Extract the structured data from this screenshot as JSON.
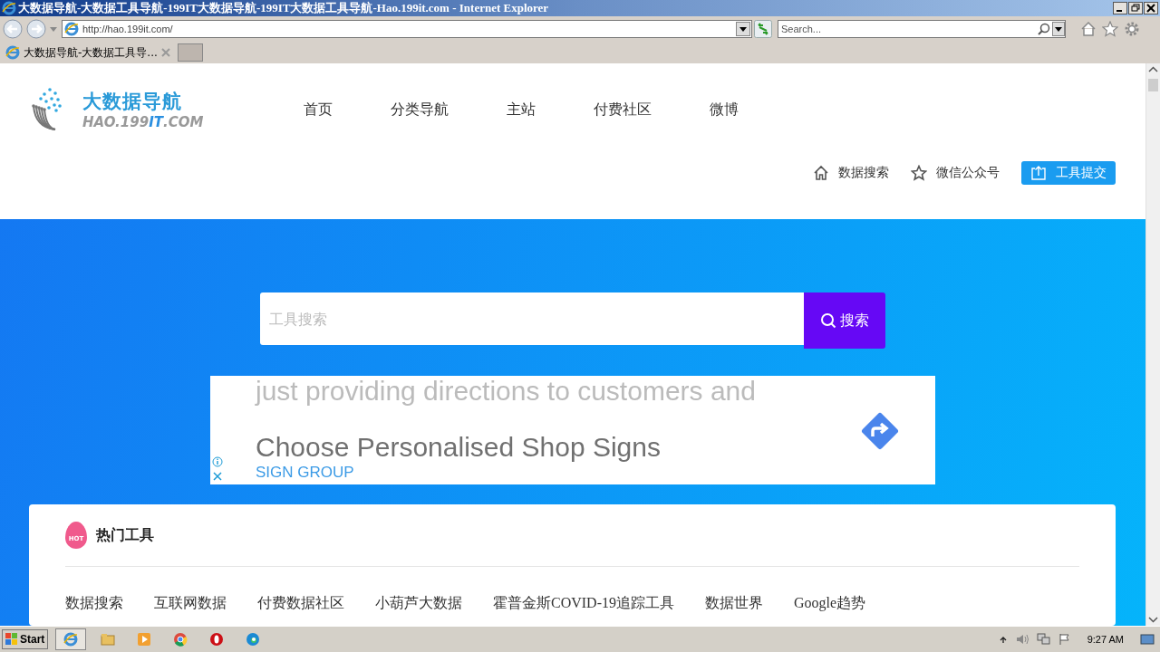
{
  "window": {
    "title": "大数据导航-大数据工具导航-199IT大数据导航-199IT大数据工具导航-Hao.199it.com - Internet Explorer"
  },
  "browser": {
    "address": "http://hao.199it.com/",
    "search_placeholder": "Search...",
    "tabs": [
      {
        "label": "大数据导航-大数据工具导...",
        "selected": true
      }
    ]
  },
  "logo": {
    "title": "大数据导航",
    "subtitle": "HAO.199**IT**.COM"
  },
  "nav": [
    "首页",
    "分类导航",
    "主站",
    "付费社区",
    "微博"
  ],
  "actions": [
    {
      "kind": "home",
      "label": "数据搜索"
    },
    {
      "kind": "star",
      "label": "微信公众号"
    },
    {
      "kind": "submit",
      "label": "工具提交"
    }
  ],
  "search": {
    "placeholder": "工具搜索",
    "button": "搜索"
  },
  "ad": {
    "line_top": "just providing directions to customers and",
    "headline": "Choose Personalised Shop Signs",
    "advertiser": "SIGN GROUP"
  },
  "hot_tools": {
    "badge": "HOT",
    "title": "热门工具",
    "items": [
      "数据搜索",
      "互联网数据",
      "付费数据社区",
      "小葫芦大数据",
      "霍普金斯COVID-19追踪工具",
      "数据世界",
      "Google趋势"
    ]
  },
  "taskbar": {
    "start": "Start",
    "clock": "9:27 AM"
  }
}
